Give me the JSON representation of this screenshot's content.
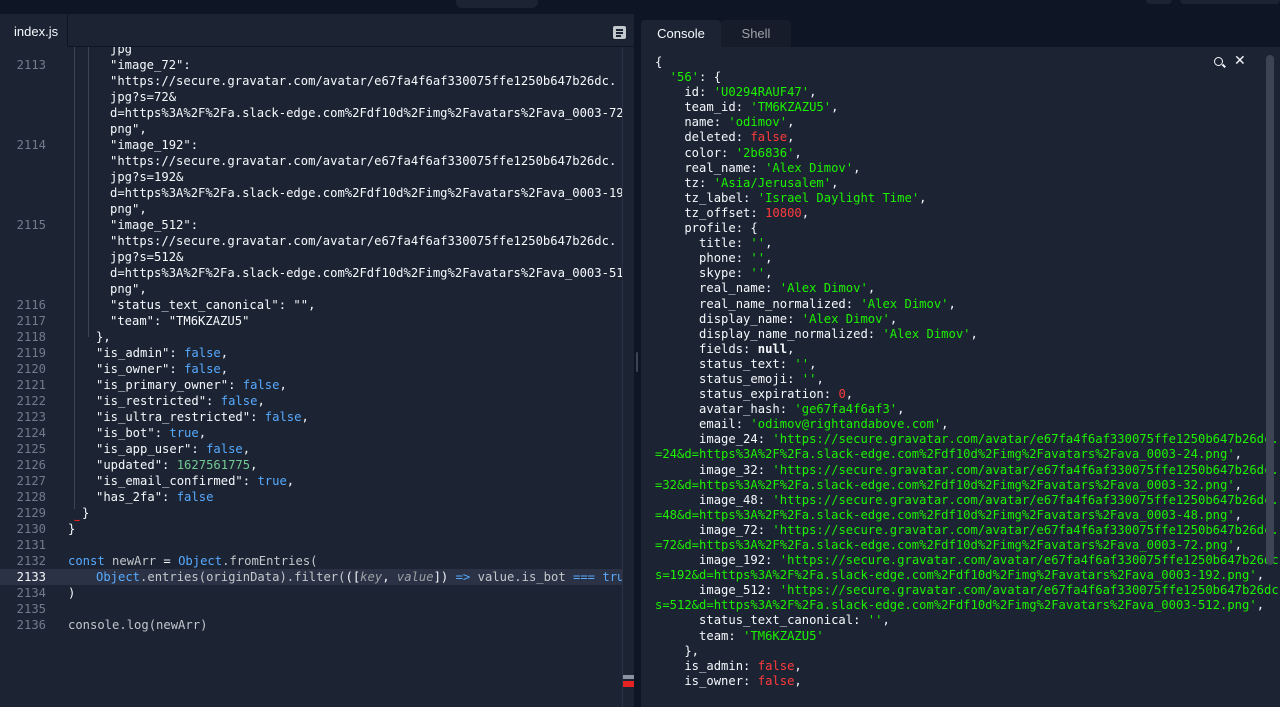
{
  "editor": {
    "tab_label": "index.js",
    "lines": [
      {
        "n": "2113",
        "parts": [
          [
            "\"image_72\": ",
            "key"
          ]
        ],
        "sub": [
          [
            [
              "\"https://secure.gravatar.com/avatar/e67fa4f6af330075ffe1250b647b26dc.",
              "str"
            ]
          ],
          [
            [
              "jpg?s=72&",
              "str"
            ]
          ],
          [
            [
              "d=https%3A%2F%2Fa.slack-edge.com%2Fdf10d%2Fimg%2Favatars%2Fava_0003-72.",
              "str"
            ]
          ],
          [
            [
              "png\",",
              "str"
            ]
          ]
        ]
      },
      {
        "n": "2114",
        "parts": [
          [
            "\"image_192\": ",
            "key"
          ]
        ],
        "sub": [
          [
            [
              "\"https://secure.gravatar.com/avatar/e67fa4f6af330075ffe1250b647b26dc.",
              "str"
            ]
          ],
          [
            [
              "jpg?s=192&",
              "str"
            ]
          ],
          [
            [
              "d=https%3A%2F%2Fa.slack-edge.com%2Fdf10d%2Fimg%2Favatars%2Fava_0003-192.",
              "str"
            ]
          ],
          [
            [
              "png\",",
              "str"
            ]
          ]
        ]
      },
      {
        "n": "2115",
        "parts": [
          [
            "\"image_512\": ",
            "key"
          ]
        ],
        "sub": [
          [
            [
              "\"https://secure.gravatar.com/avatar/e67fa4f6af330075ffe1250b647b26dc.",
              "str"
            ]
          ],
          [
            [
              "jpg?s=512&",
              "str"
            ]
          ],
          [
            [
              "d=https%3A%2F%2Fa.slack-edge.com%2Fdf10d%2Fimg%2Favatars%2Fava_0003-512.",
              "str"
            ]
          ],
          [
            [
              "png\",",
              "str"
            ]
          ]
        ]
      },
      {
        "n": "2116",
        "parts": [
          [
            "\"status_text_canonical\": \"\",",
            "key"
          ]
        ]
      },
      {
        "n": "2117",
        "parts": [
          [
            "\"team\": \"TM6KZAZU5\"",
            "key"
          ]
        ]
      },
      {
        "n": "2118",
        "parts": [
          [
            "},",
            "op"
          ]
        ]
      },
      {
        "n": "2119",
        "parts": [
          [
            "\"is_admin\": ",
            "key"
          ],
          [
            "false",
            "bool"
          ],
          [
            ",",
            "op"
          ]
        ]
      },
      {
        "n": "2120",
        "parts": [
          [
            "\"is_owner\": ",
            "key"
          ],
          [
            "false",
            "bool"
          ],
          [
            ",",
            "op"
          ]
        ]
      },
      {
        "n": "2121",
        "parts": [
          [
            "\"is_primary_owner\": ",
            "key"
          ],
          [
            "false",
            "bool"
          ],
          [
            ",",
            "op"
          ]
        ]
      },
      {
        "n": "2122",
        "parts": [
          [
            "\"is_restricted\": ",
            "key"
          ],
          [
            "false",
            "bool"
          ],
          [
            ",",
            "op"
          ]
        ]
      },
      {
        "n": "2123",
        "parts": [
          [
            "\"is_ultra_restricted\": ",
            "key"
          ],
          [
            "false",
            "bool"
          ],
          [
            ",",
            "op"
          ]
        ]
      },
      {
        "n": "2124",
        "parts": [
          [
            "\"is_bot\": ",
            "key"
          ],
          [
            "true",
            "bool"
          ],
          [
            ",",
            "op"
          ]
        ]
      },
      {
        "n": "2125",
        "parts": [
          [
            "\"is_app_user\": ",
            "key"
          ],
          [
            "false",
            "bool"
          ],
          [
            ",",
            "op"
          ]
        ]
      },
      {
        "n": "2126",
        "parts": [
          [
            "\"updated\": ",
            "key"
          ],
          [
            "1627561775",
            "num"
          ],
          [
            ",",
            "op"
          ]
        ]
      },
      {
        "n": "2127",
        "parts": [
          [
            "\"is_email_confirmed\": ",
            "key"
          ],
          [
            "true",
            "bool"
          ],
          [
            ",",
            "op"
          ]
        ]
      },
      {
        "n": "2128",
        "parts": [
          [
            "\"has_2fa\": ",
            "key"
          ],
          [
            "false",
            "bool"
          ]
        ]
      },
      {
        "n": "2129",
        "parts": [
          [
            "}",
            "op"
          ]
        ]
      },
      {
        "n": "2130",
        "parts": [
          [
            "}",
            "op"
          ]
        ]
      },
      {
        "n": "2131",
        "parts": []
      },
      {
        "n": "2132",
        "parts": [
          [
            "const ",
            "kw"
          ],
          [
            "newArr",
            "fn"
          ],
          [
            " = ",
            "op"
          ],
          [
            "Object",
            "cls"
          ],
          [
            ".fromEntries(",
            "fn"
          ]
        ]
      },
      {
        "n": "2133",
        "parts": [
          [
            "Object",
            "cls"
          ],
          [
            ".entries(originData).filter(",
            "fn"
          ],
          [
            "(",
            "op"
          ],
          [
            "[",
            "op"
          ],
          [
            "key",
            "param"
          ],
          [
            ", ",
            "op"
          ],
          [
            "value",
            "param"
          ],
          [
            "]",
            "op"
          ],
          [
            ")",
            "op"
          ],
          [
            " => ",
            "kw"
          ],
          [
            "value.is_bot ",
            "fn"
          ],
          [
            "=== ",
            "kw"
          ],
          [
            "true",
            "bool"
          ],
          [
            ")",
            "op"
          ]
        ]
      },
      {
        "n": "2134",
        "parts": [
          [
            ")",
            "op"
          ]
        ]
      },
      {
        "n": "2135",
        "parts": []
      },
      {
        "n": "2136",
        "parts": [
          [
            "console.log(newArr)",
            "fn"
          ]
        ]
      }
    ],
    "top_partial": "jpg"
  },
  "console": {
    "tabs": [
      "Console",
      "Shell"
    ],
    "icons": {
      "search": "search-icon",
      "close": "close-icon"
    },
    "lines": [
      [
        [
          "{",
          "p"
        ]
      ],
      [
        [
          "  '56'",
          "s"
        ],
        [
          ": {",
          "p"
        ]
      ],
      [
        [
          "    id: ",
          "p"
        ],
        [
          "'U0294RAUF47'",
          "s"
        ],
        [
          ",",
          "p"
        ]
      ],
      [
        [
          "    team_id: ",
          "p"
        ],
        [
          "'TM6KZAZU5'",
          "s"
        ],
        [
          ",",
          "p"
        ]
      ],
      [
        [
          "    name: ",
          "p"
        ],
        [
          "'odimov'",
          "s"
        ],
        [
          ",",
          "p"
        ]
      ],
      [
        [
          "    deleted: ",
          "p"
        ],
        [
          "false",
          "r"
        ],
        [
          ",",
          "p"
        ]
      ],
      [
        [
          "    color: ",
          "p"
        ],
        [
          "'2b6836'",
          "s"
        ],
        [
          ",",
          "p"
        ]
      ],
      [
        [
          "    real_name: ",
          "p"
        ],
        [
          "'Alex Dimov'",
          "s"
        ],
        [
          ",",
          "p"
        ]
      ],
      [
        [
          "    tz: ",
          "p"
        ],
        [
          "'Asia/Jerusalem'",
          "s"
        ],
        [
          ",",
          "p"
        ]
      ],
      [
        [
          "    tz_label: ",
          "p"
        ],
        [
          "'Israel Daylight Time'",
          "s"
        ],
        [
          ",",
          "p"
        ]
      ],
      [
        [
          "    tz_offset: ",
          "p"
        ],
        [
          "10800",
          "r"
        ],
        [
          ",",
          "p"
        ]
      ],
      [
        [
          "    profile: {",
          "p"
        ]
      ],
      [
        [
          "      title: ",
          "p"
        ],
        [
          "''",
          "s"
        ],
        [
          ",",
          "p"
        ]
      ],
      [
        [
          "      phone: ",
          "p"
        ],
        [
          "''",
          "s"
        ],
        [
          ",",
          "p"
        ]
      ],
      [
        [
          "      skype: ",
          "p"
        ],
        [
          "''",
          "s"
        ],
        [
          ",",
          "p"
        ]
      ],
      [
        [
          "      real_name: ",
          "p"
        ],
        [
          "'Alex Dimov'",
          "s"
        ],
        [
          ",",
          "p"
        ]
      ],
      [
        [
          "      real_name_normalized: ",
          "p"
        ],
        [
          "'Alex Dimov'",
          "s"
        ],
        [
          ",",
          "p"
        ]
      ],
      [
        [
          "      display_name: ",
          "p"
        ],
        [
          "'Alex Dimov'",
          "s"
        ],
        [
          ",",
          "p"
        ]
      ],
      [
        [
          "      display_name_normalized: ",
          "p"
        ],
        [
          "'Alex Dimov'",
          "s"
        ],
        [
          ",",
          "p"
        ]
      ],
      [
        [
          "      fields: ",
          "p"
        ],
        [
          "null",
          "b"
        ],
        [
          ",",
          "p"
        ]
      ],
      [
        [
          "      status_text: ",
          "p"
        ],
        [
          "''",
          "s"
        ],
        [
          ",",
          "p"
        ]
      ],
      [
        [
          "      status_emoji: ",
          "p"
        ],
        [
          "''",
          "s"
        ],
        [
          ",",
          "p"
        ]
      ],
      [
        [
          "      status_expiration: ",
          "p"
        ],
        [
          "0",
          "r"
        ],
        [
          ",",
          "p"
        ]
      ],
      [
        [
          "      avatar_hash: ",
          "p"
        ],
        [
          "'ge67fa4f6af3'",
          "s"
        ],
        [
          ",",
          "p"
        ]
      ],
      [
        [
          "      email: ",
          "p"
        ],
        [
          "'odimov@rightandabove.com'",
          "s"
        ],
        [
          ",",
          "p"
        ]
      ],
      [
        [
          "      image_24: ",
          "p"
        ],
        [
          "'https://secure.gravatar.com/avatar/e67fa4f6af330075ffe1250b647b26dc.jpg?s",
          "s"
        ]
      ],
      [
        [
          "=24&d=https%3A%2F%2Fa.slack-edge.com%2Fdf10d%2Fimg%2Favatars%2Fava_0003-24.png'",
          "s"
        ],
        [
          ",",
          "p"
        ]
      ],
      [
        [
          "      image_32: ",
          "p"
        ],
        [
          "'https://secure.gravatar.com/avatar/e67fa4f6af330075ffe1250b647b26dc.jpg?s",
          "s"
        ]
      ],
      [
        [
          "=32&d=https%3A%2F%2Fa.slack-edge.com%2Fdf10d%2Fimg%2Favatars%2Fava_0003-32.png'",
          "s"
        ],
        [
          ",",
          "p"
        ]
      ],
      [
        [
          "      image_48: ",
          "p"
        ],
        [
          "'https://secure.gravatar.com/avatar/e67fa4f6af330075ffe1250b647b26dc.jpg?s",
          "s"
        ]
      ],
      [
        [
          "=48&d=https%3A%2F%2Fa.slack-edge.com%2Fdf10d%2Fimg%2Favatars%2Fava_0003-48.png'",
          "s"
        ],
        [
          ",",
          "p"
        ]
      ],
      [
        [
          "      image_72: ",
          "p"
        ],
        [
          "'https://secure.gravatar.com/avatar/e67fa4f6af330075ffe1250b647b26dc.jpg?s",
          "s"
        ]
      ],
      [
        [
          "=72&d=https%3A%2F%2Fa.slack-edge.com%2Fdf10d%2Fimg%2Favatars%2Fava_0003-72.png'",
          "s"
        ],
        [
          ",",
          "p"
        ]
      ],
      [
        [
          "      image_192: ",
          "p"
        ],
        [
          "'https://secure.gravatar.com/avatar/e67fa4f6af330075ffe1250b647b26dc.jpg?",
          "s"
        ]
      ],
      [
        [
          "s=192&d=https%3A%2F%2Fa.slack-edge.com%2Fdf10d%2Fimg%2Favatars%2Fava_0003-192.png'",
          "s"
        ],
        [
          ",",
          "p"
        ]
      ],
      [
        [
          "      image_512: ",
          "p"
        ],
        [
          "'https://secure.gravatar.com/avatar/e67fa4f6af330075ffe1250b647b26dc.jpg?",
          "s"
        ]
      ],
      [
        [
          "s=512&d=https%3A%2F%2Fa.slack-edge.com%2Fdf10d%2Fimg%2Favatars%2Fava_0003-512.png'",
          "s"
        ],
        [
          ",",
          "p"
        ]
      ],
      [
        [
          "      status_text_canonical: ",
          "p"
        ],
        [
          "''",
          "s"
        ],
        [
          ",",
          "p"
        ]
      ],
      [
        [
          "      team: ",
          "p"
        ],
        [
          "'TM6KZAZU5'",
          "s"
        ]
      ],
      [
        [
          "    },",
          "p"
        ]
      ],
      [
        [
          "    is_admin: ",
          "p"
        ],
        [
          "false",
          "r"
        ],
        [
          ",",
          "p"
        ]
      ],
      [
        [
          "    is_owner: ",
          "p"
        ],
        [
          "false",
          "r"
        ],
        [
          ",",
          "p"
        ]
      ]
    ]
  },
  "colors": {
    "background": "#0e1525",
    "panel": "#1c2333",
    "string_green": "#1df200",
    "literal_red": "#ff3b3b",
    "keyword_blue": "#57abff",
    "number_green": "#73c991"
  }
}
